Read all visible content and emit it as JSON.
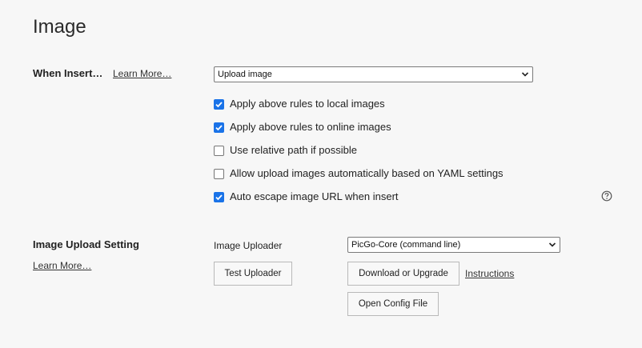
{
  "page": {
    "title": "Image"
  },
  "when_insert": {
    "label": "When Insert…",
    "learn_more": "Learn More…",
    "select_value": "Upload image",
    "checkboxes": [
      {
        "label": "Apply above rules to local images",
        "checked": true
      },
      {
        "label": "Apply above rules to online images",
        "checked": true
      },
      {
        "label": "Use relative path if possible",
        "checked": false
      },
      {
        "label": "Allow upload images automatically based on YAML settings",
        "checked": false
      },
      {
        "label": "Auto escape image URL when insert",
        "checked": true
      }
    ],
    "help_icon": "question-circle-icon"
  },
  "upload_setting": {
    "label": "Image Upload Setting",
    "learn_more": "Learn More…",
    "uploader_label": "Image Uploader",
    "uploader_value": "PicGo-Core (command line)",
    "test_button": "Test Uploader",
    "download_button": "Download or Upgrade",
    "instructions_link": "Instructions",
    "config_button": "Open Config File"
  },
  "colors": {
    "accent": "#1a73e8",
    "background": "#f7f7f7"
  }
}
